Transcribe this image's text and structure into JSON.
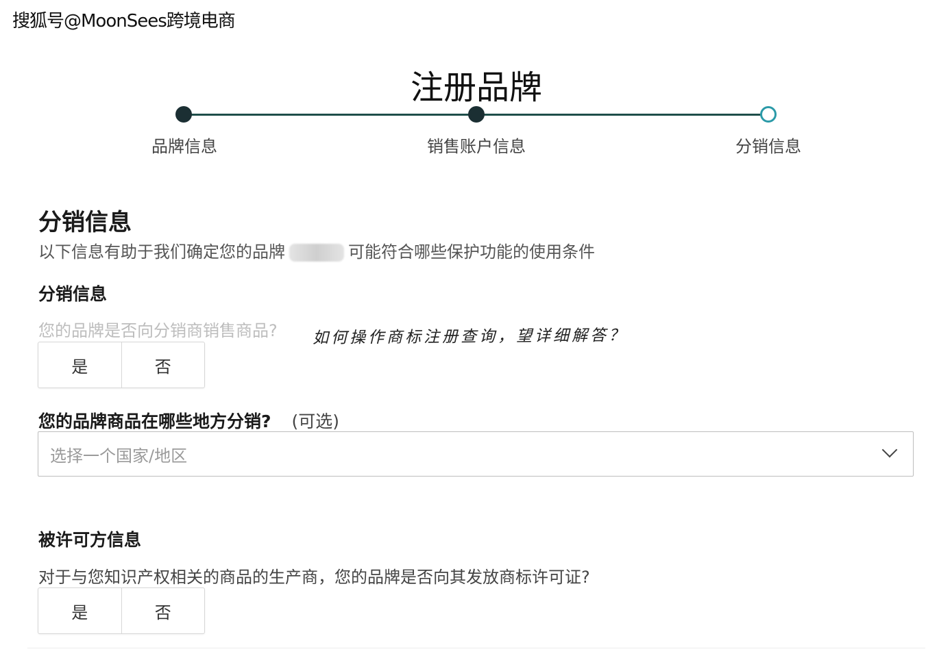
{
  "watermark": "搜狐号@MoonSees跨境电商",
  "page_title": "注册品牌",
  "steps": [
    {
      "label": "品牌信息",
      "state": "completed"
    },
    {
      "label": "销售账户信息",
      "state": "completed"
    },
    {
      "label": "分销信息",
      "state": "current"
    }
  ],
  "distribution": {
    "title": "分销信息",
    "description_before": "以下信息有助于我们确定您的品牌",
    "description_after": "可能符合哪些保护功能的使用条件",
    "subtitle": "分销信息",
    "question": "您的品牌是否向分销商销售商品?",
    "yes": "是",
    "no": "否",
    "where_title": "您的品牌商品在哪些地方分销?",
    "where_optional": "(可选)",
    "country_placeholder": "选择一个国家/地区"
  },
  "annotation": "如何操作商标注册查询，望详细解答？",
  "license": {
    "title": "被许可方信息",
    "question": "对于与您知识产权相关的商品的生产商，您的品牌是否向其发放商标许可证?",
    "yes": "是",
    "no": "否"
  },
  "colors": {
    "step_line": "#1e4e4a",
    "step_dot": "#1b2f33",
    "step_current_ring": "#2b9aa8"
  }
}
